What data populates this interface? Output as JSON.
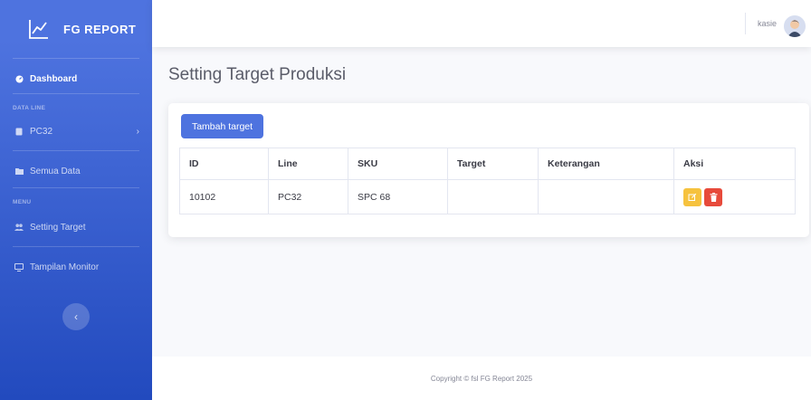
{
  "brand": {
    "name": "FG REPORT",
    "icon": "chart-line-icon"
  },
  "sidebar": {
    "dashboard": "Dashboard",
    "heading_data_line": "DATA LINE",
    "pc32": "PC32",
    "semua_data": "Semua Data",
    "heading_menu": "MENU",
    "setting_target": "Setting Target",
    "tampilan_monitor": "Tampilan Monitor",
    "toggle_icon": "chevron-left-icon"
  },
  "topbar": {
    "user": "kasie",
    "avatar_icon": "user-avatar-icon"
  },
  "main": {
    "title": "Setting Target Produksi",
    "add_button": "Tambah target",
    "table": {
      "headers": [
        "ID",
        "Line",
        "SKU",
        "Target",
        "Keterangan",
        "Aksi"
      ],
      "rows": [
        {
          "id": "10102",
          "line": "PC32",
          "sku": "SPC 68",
          "target": "",
          "keterangan": ""
        }
      ]
    }
  },
  "footer": {
    "copyright": "Copyright © fsl FG Report 2025"
  },
  "colors": {
    "primary": "#4e73df",
    "warning": "#f6c23e",
    "danger": "#e74a3b"
  }
}
